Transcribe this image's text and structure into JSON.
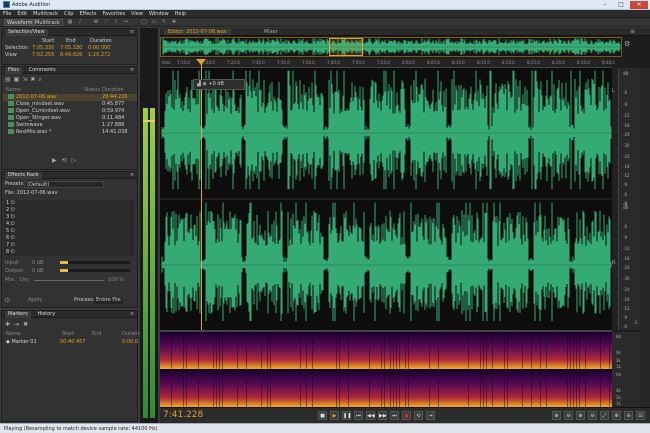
{
  "app": {
    "title": "Adobe Audition"
  },
  "menu": [
    "File",
    "Edit",
    "Multitrack",
    "Clip",
    "Effects",
    "Favorites",
    "View",
    "Window",
    "Help"
  ],
  "toolbar": {
    "waveform": "Waveform",
    "multitrack": "Multitrack"
  },
  "selection_view": {
    "tabs": [
      "Selection/View"
    ],
    "headers": [
      "Start",
      "End",
      "Duration"
    ],
    "rows": [
      {
        "label": "Selection",
        "start": "7:05.330",
        "end": "7:05.330",
        "duration": "0:00.000"
      },
      {
        "label": "View",
        "start": "7:02.255",
        "end": "8:49.826",
        "duration": "1:20.272"
      }
    ]
  },
  "files": {
    "tabs": [
      "Files",
      "Comments"
    ],
    "headers": [
      "Name",
      "Status",
      "Duration"
    ],
    "items": [
      {
        "name": "2012-07-06.wav",
        "duration": "29:44.226"
      },
      {
        "name": "Close_mindset.wav",
        "duration": "0:45.877"
      },
      {
        "name": "Open_CLmindset.wav",
        "duration": "0:59.974"
      },
      {
        "name": "Open_Stinger.wav",
        "duration": "0:11.484"
      },
      {
        "name": "Swimwave",
        "duration": "1:27.888"
      },
      {
        "name": "RestMix.wav *",
        "duration": "14:41.038"
      }
    ]
  },
  "effects_rack": {
    "title": "Effects Rack",
    "presets_label": "Presets:",
    "presets_value": "(Default)",
    "file_label": "File: 2012-07-06.wav",
    "slots": [
      "1",
      "2",
      "3",
      "4",
      "5",
      "6",
      "7",
      "8"
    ],
    "input_label": "Input:",
    "input_db": "0 dB",
    "output_label": "Output:",
    "output_db": "0 dB",
    "mix_label": "Mix:",
    "mix_dry": "Dry",
    "mix_wet": "100 %",
    "apply_label": "Apply",
    "process_label": "Process:",
    "process_value": "Entire File"
  },
  "markers": {
    "tabs": [
      "Markers",
      "History"
    ],
    "headers": [
      "Name",
      "Start",
      "End",
      "Duration"
    ],
    "items": [
      {
        "name": "Marker 01",
        "start": "00:40.457",
        "duration": "0:00.0"
      }
    ]
  },
  "editor": {
    "tabs": [
      "Editor: 2012-07-06.wav",
      "Mixer"
    ],
    "ruler_labels": [
      "hms",
      "7:15.0",
      "7:20.0",
      "7:25.0",
      "7:30.0",
      "7:35.0",
      "7:40.0",
      "7:45.0",
      "7:50.0",
      "7:55.0",
      "8:00.0",
      "8:05.0",
      "8:10.0",
      "8:15.0",
      "8:20.0",
      "8:25.0",
      "8:30.0",
      "8:35.0",
      "8:40.0"
    ],
    "hud_gain": "+0 dB",
    "db_scale_top": [
      "dB",
      "-6",
      "-9",
      "-12",
      "-18",
      "-24",
      "-30",
      "-24",
      "-18",
      "-12",
      "-9",
      "-6",
      "-3",
      "-6"
    ],
    "db_scale_bottom": [
      "dB",
      "-6",
      "-9",
      "-12",
      "-18",
      "-24",
      "-30",
      "-24",
      "-18",
      "-12",
      "-9",
      "-6",
      "-3"
    ],
    "spec_labels": [
      "Hz",
      "4k",
      "2k",
      "1k",
      "Hz",
      "4k",
      "2k",
      "1k"
    ],
    "timecode": "7:41.228",
    "colors": {
      "waveform": "#3fd38f",
      "accent": "#e1a030",
      "selection": "#7a5a1a"
    }
  },
  "status": {
    "text": "Playing (Resampling to match device sample rate: 44100 Hz)"
  }
}
